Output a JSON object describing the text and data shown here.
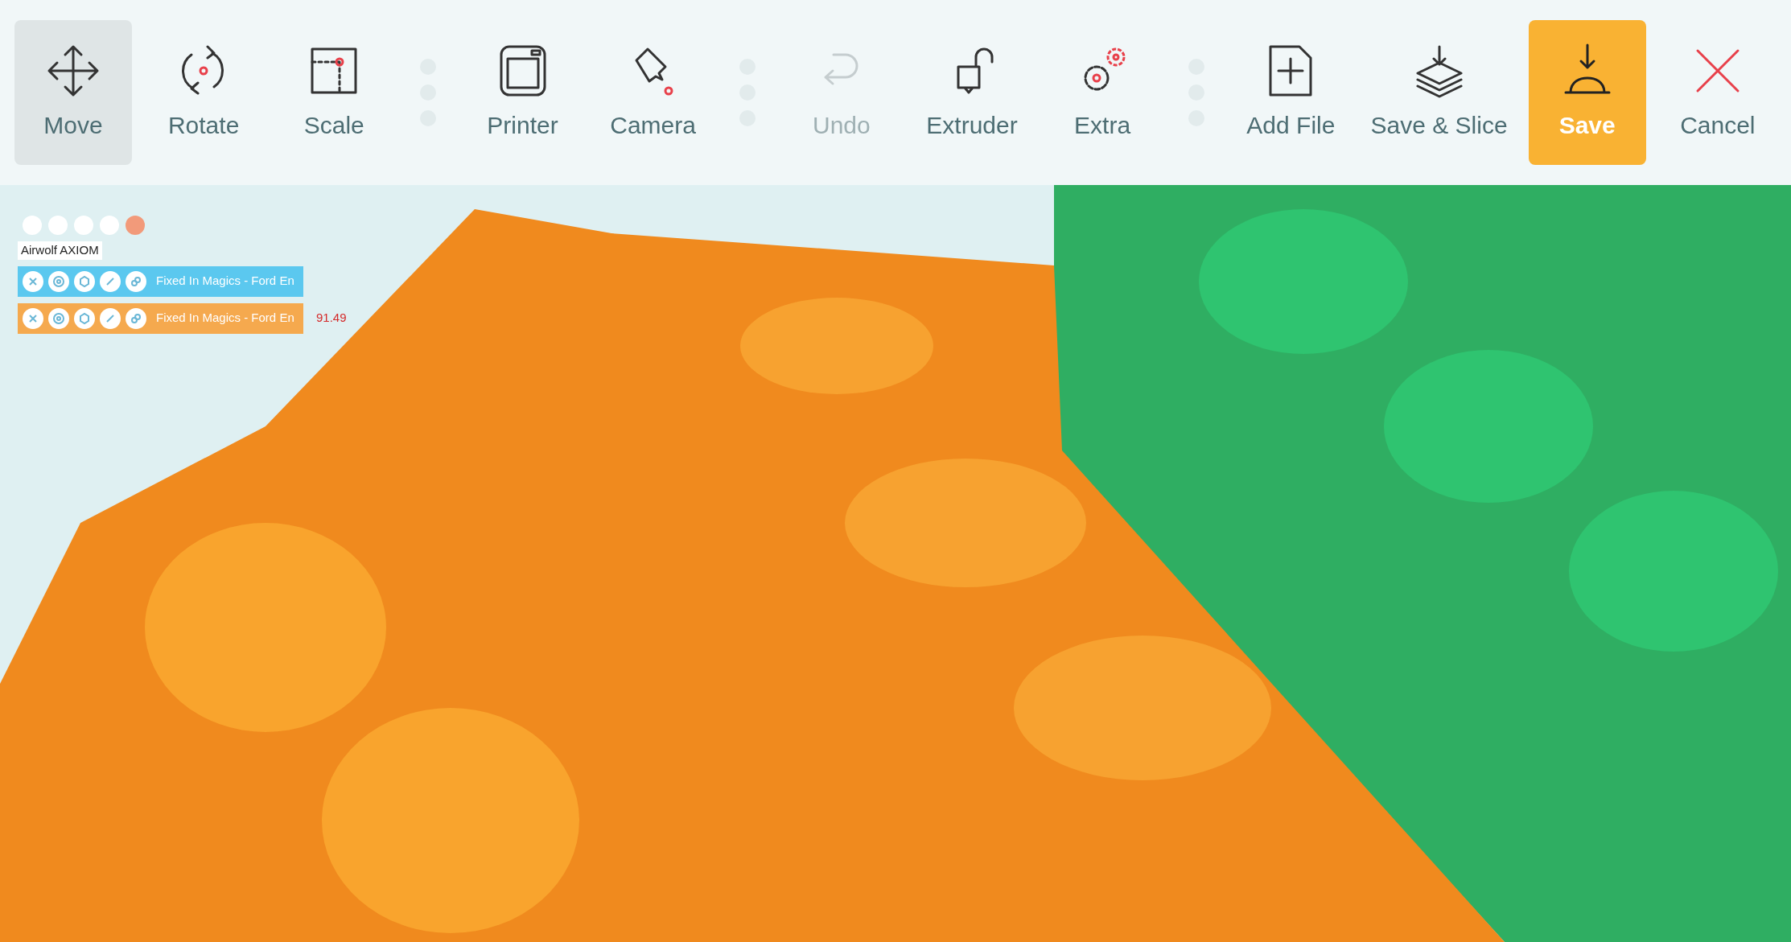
{
  "toolbar": {
    "items": [
      {
        "kind": "tool",
        "label": "Move",
        "selected": true,
        "disabled": false
      },
      {
        "kind": "tool",
        "label": "Rotate",
        "selected": false,
        "disabled": false
      },
      {
        "kind": "tool",
        "label": "Scale",
        "selected": false,
        "disabled": false
      },
      {
        "kind": "separator"
      },
      {
        "kind": "tool",
        "label": "Printer",
        "selected": false,
        "disabled": false
      },
      {
        "kind": "tool",
        "label": "Camera",
        "selected": false,
        "disabled": false
      },
      {
        "kind": "separator"
      },
      {
        "kind": "tool",
        "label": "Undo",
        "selected": false,
        "disabled": true
      },
      {
        "kind": "tool",
        "label": "Extruder",
        "selected": false,
        "disabled": false
      },
      {
        "kind": "tool",
        "label": "Extra",
        "selected": false,
        "disabled": false
      },
      {
        "kind": "separator"
      },
      {
        "kind": "tool",
        "label": "Add File",
        "selected": false,
        "disabled": false
      },
      {
        "kind": "tool",
        "label": "Save & Slice",
        "selected": false,
        "disabled": false
      },
      {
        "kind": "primary",
        "label": "Save"
      },
      {
        "kind": "tool",
        "label": "Cancel",
        "selected": false,
        "disabled": false
      }
    ]
  },
  "scene": {
    "printer_name": "Airwolf AXIOM",
    "objects": [
      {
        "name": "Fixed In Magics - Ford En",
        "color": "#5bc8ef"
      },
      {
        "name": "Fixed In Magics - Ford En",
        "color": "#f5a94e",
        "reading": "91.49"
      }
    ]
  }
}
